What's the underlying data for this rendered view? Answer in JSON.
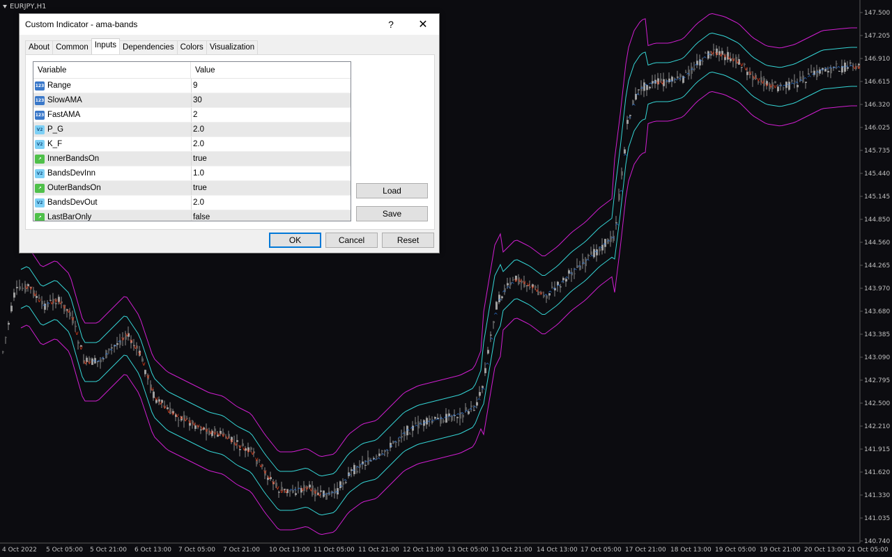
{
  "chart": {
    "symbol": "EURJPY,H1",
    "price_labels": [
      "147.500",
      "147.205",
      "146.910",
      "146.615",
      "146.320",
      "146.025",
      "145.735",
      "145.440",
      "145.145",
      "144.850",
      "144.560",
      "144.265",
      "143.970",
      "143.680",
      "143.385",
      "143.090",
      "142.795",
      "142.500",
      "142.210",
      "141.915",
      "141.620",
      "141.330",
      "141.035",
      "140.740"
    ],
    "time_labels": [
      "4 Oct 2022",
      "5 Oct 05:00",
      "5 Oct 21:00",
      "6 Oct 13:00",
      "7 Oct 05:00",
      "7 Oct 21:00",
      "10 Oct 13:00",
      "11 Oct 05:00",
      "11 Oct 21:00",
      "12 Oct 13:00",
      "13 Oct 05:00",
      "13 Oct 21:00",
      "14 Oct 13:00",
      "17 Oct 05:00",
      "17 Oct 21:00",
      "18 Oct 13:00",
      "19 Oct 05:00",
      "19 Oct 21:00",
      "20 Oct 13:00",
      "21 Oct 05:00"
    ],
    "colors": {
      "background": "#0c0c10",
      "candle": "#9a9a9a",
      "outer_band": "#d21ed2",
      "inner_band": "#35d6d6",
      "ama_up": "#2f7de0",
      "ama_down": "#e8411c"
    }
  },
  "dialog": {
    "title": "Custom Indicator - ama-bands",
    "help": "?",
    "close": "✕",
    "tabs": [
      "About",
      "Common",
      "Inputs",
      "Dependencies",
      "Colors",
      "Visualization"
    ],
    "active_tab": "Inputs",
    "columns": [
      "Variable",
      "Value"
    ],
    "rows": [
      {
        "name": "Range",
        "value": "9",
        "type": "int"
      },
      {
        "name": "SlowAMA",
        "value": "30",
        "type": "int"
      },
      {
        "name": "FastAMA",
        "value": "2",
        "type": "int"
      },
      {
        "name": "P_G",
        "value": "2.0",
        "type": "double"
      },
      {
        "name": "K_F",
        "value": "2.0",
        "type": "double"
      },
      {
        "name": "InnerBandsOn",
        "value": "true",
        "type": "bool"
      },
      {
        "name": "BandsDevInn",
        "value": "1.0",
        "type": "double"
      },
      {
        "name": "OuterBandsOn",
        "value": "true",
        "type": "bool"
      },
      {
        "name": "BandsDevOut",
        "value": "2.0",
        "type": "double"
      },
      {
        "name": "LastBarOnly",
        "value": "false",
        "type": "bool"
      }
    ],
    "buttons": {
      "load": "Load",
      "save": "Save",
      "ok": "OK",
      "cancel": "Cancel",
      "reset": "Reset"
    }
  }
}
